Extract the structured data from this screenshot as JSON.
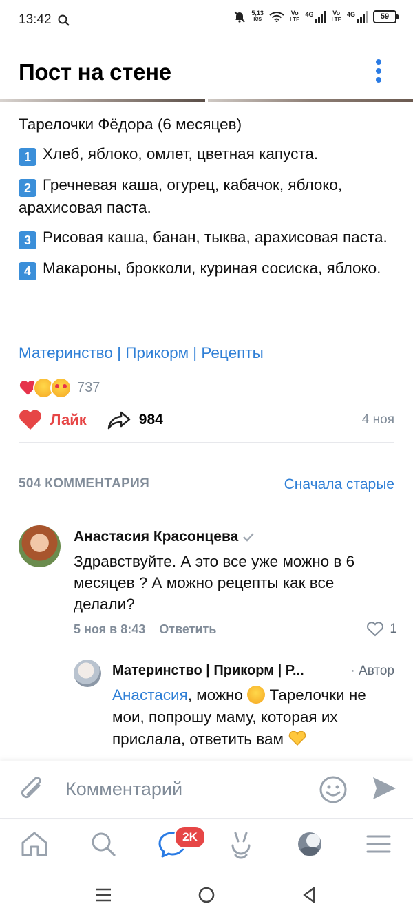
{
  "status_bar": {
    "time": "13:42",
    "net_speed_value": "5,13",
    "net_speed_unit": "K/S",
    "sim1": "Vo LTE",
    "sim1_gen": "4G",
    "sim2": "Vo LTE",
    "sim2_gen": "4G",
    "battery": "59"
  },
  "header": {
    "title": "Пост на стене"
  },
  "post": {
    "intro": "Тарелочки Фёдора (6 месяцев)",
    "items": [
      {
        "num": "1",
        "text": "Хлеб, яблоко, омлет, цветная капуста."
      },
      {
        "num": "2",
        "text": "Гречневая каша, огурец, кабачок, яблоко, арахисовая паста."
      },
      {
        "num": "3",
        "text": "Рисовая каша, банан, тыква, арахисовая паста."
      },
      {
        "num": "4",
        "text": "Макароны, брокколи, куриная сосиска, яблоко."
      }
    ],
    "hashtags": "Материнство | Прикорм | Рецепты",
    "reactions_count": "737",
    "like_label": "Лайк",
    "share_count": "984",
    "date": "4 ноя"
  },
  "comments_header": {
    "count": "504 КОММЕНТАРИЯ",
    "sort": "Сначала старые"
  },
  "comment": {
    "author": "Анастасия Красонцева",
    "text": "Здравствуйте.  А это все уже можно в 6 месяцев ? А можно рецепты как все делали?",
    "time": "5 ноя в 8:43",
    "reply_label": "Ответить",
    "likes": "1"
  },
  "reply": {
    "author": "Материнство | Прикорм | Р...",
    "badge": "· Автор",
    "mention": "Анастасия",
    "text_a": ", можно ",
    "text_b": " Тарелочки не мои, попрошу маму, которая их прислала, ответить вам "
  },
  "input": {
    "placeholder": "Комментарий"
  },
  "tabbar": {
    "messages_badge": "2K"
  },
  "colors": {
    "accent": "#2f7fd6",
    "like": "#e64646",
    "muted": "#818c99"
  }
}
